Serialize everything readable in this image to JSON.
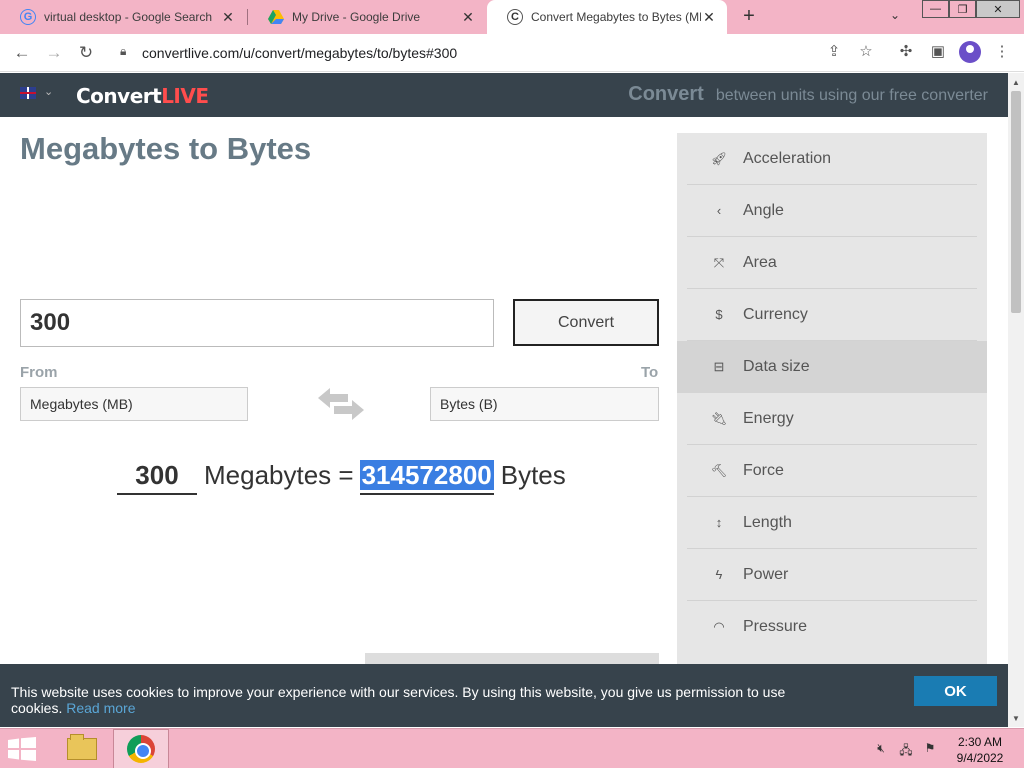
{
  "browser": {
    "tabs": [
      {
        "title": "virtual desktop - Google Search",
        "icon": "google-icon"
      },
      {
        "title": "My Drive - Google Drive",
        "icon": "google-drive-icon"
      },
      {
        "title": "Convert Megabytes to Bytes (MB",
        "icon": "convertlive-icon"
      }
    ],
    "url": "convertlive.com/u/convert/megabytes/to/bytes#300"
  },
  "header": {
    "logo_part1": "Convert",
    "logo_part2": "LIVE",
    "tagline_strong": "Convert",
    "tagline_rest": "between units using our free converter"
  },
  "main": {
    "title": "Megabytes to Bytes",
    "input_value": "300",
    "convert_label": "Convert",
    "from_label": "From",
    "to_label": "To",
    "from_unit": "Megabytes (MB)",
    "to_unit": "Bytes (B)",
    "result": {
      "amount": "300",
      "from_unit": "Megabytes =",
      "value": "314572800",
      "to_unit": "Bytes"
    }
  },
  "sidebar": {
    "items": [
      {
        "label": "Acceleration",
        "icon": "rocket-icon"
      },
      {
        "label": "Angle",
        "icon": "angle-icon"
      },
      {
        "label": "Area",
        "icon": "expand-icon"
      },
      {
        "label": "Currency",
        "icon": "dollar-icon"
      },
      {
        "label": "Data size",
        "icon": "drive-icon",
        "active": true
      },
      {
        "label": "Energy",
        "icon": "plug-icon"
      },
      {
        "label": "Force",
        "icon": "hammer-icon"
      },
      {
        "label": "Length",
        "icon": "arrows-vertical-icon"
      },
      {
        "label": "Power",
        "icon": "bolt-icon"
      },
      {
        "label": "Pressure",
        "icon": "gauge-icon"
      }
    ]
  },
  "cookie": {
    "text": "This website uses cookies to improve your experience with our services. By using this website, you give us permission to use cookies.",
    "link": "Read more",
    "ok": "OK"
  },
  "taskbar": {
    "time": "2:30 AM",
    "date": "9/4/2022"
  },
  "colors": {
    "header_bg": "#37434c",
    "accent_red": "#ff4d4d",
    "selection": "#3a7ee2",
    "ok_button": "#1a7cb3",
    "taskbar": "#f3b4c6"
  }
}
